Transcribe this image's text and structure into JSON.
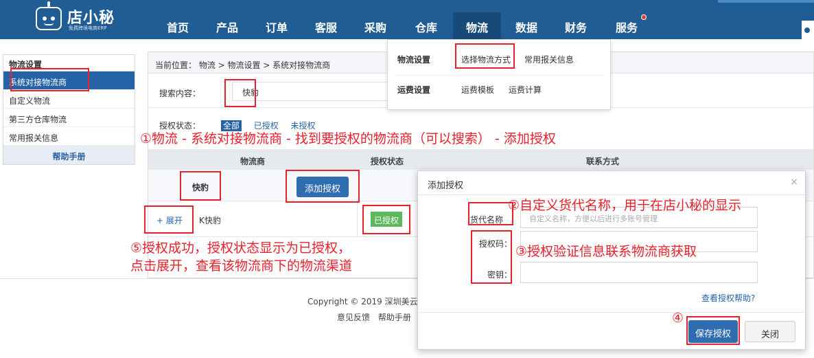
{
  "header": {
    "logo_name": "店小秘",
    "logo_sub": "免费跨境电商ERP",
    "nav": [
      "首页",
      "产品",
      "订单",
      "客服",
      "采购",
      "仓库",
      "物流",
      "数据",
      "财务",
      "服务"
    ]
  },
  "sidebar": {
    "title": "物流设置",
    "items": [
      "系统对接物流商",
      "自定义物流",
      "第三方仓库物流",
      "常用报关信息"
    ],
    "help": "帮助手册"
  },
  "breadcrumb": "当前位置： 物流 > 物流设置 > 系统对接物流商",
  "search": {
    "label": "搜索内容：",
    "value": "快豹"
  },
  "auth_filter": {
    "label": "授权状态：",
    "options": [
      "全部",
      "已授权",
      "未授权"
    ]
  },
  "table": {
    "columns": [
      "物流商",
      "授权状态",
      "联系方式"
    ],
    "group_name": "快豹",
    "add_auth_button": "添加授权",
    "row": {
      "expand": "+ 展开",
      "name": "K快豹",
      "status": "已授权"
    }
  },
  "footer": {
    "copyright": "Copyright © 2019 深圳美云",
    "links": [
      "意见反馈",
      "帮助手册"
    ]
  },
  "dropdown": {
    "groups": [
      {
        "title": "物流设置",
        "items": [
          "选择物流方式",
          "常用报关信息"
        ]
      },
      {
        "title": "运费设置",
        "items": [
          "运费模板",
          "运费计算"
        ]
      }
    ]
  },
  "modal": {
    "title": "添加授权",
    "close_icon": "×",
    "fields": [
      {
        "label": "货代名称",
        "placeholder": "自定义名称，方便以后进行多账号管理"
      },
      {
        "label": "授权码：",
        "placeholder": ""
      },
      {
        "label": "密钥：",
        "placeholder": ""
      }
    ],
    "help_link": "查看授权帮助?",
    "save_button": "保存授权",
    "close_button": "关闭"
  },
  "annotations": {
    "step1": "①物流 - 系统对接物流商 - 找到要授权的物流商（可以搜索） - 添加授权",
    "step2": "②自定义货代名称，用于在店小秘的显示",
    "step3": "③授权验证信息联系物流商获取",
    "step4": "④",
    "step5_line1": "⑤授权成功，授权状态显示为已授权，",
    "step5_line2": "点击展开，查看该物流商下的物流渠道"
  },
  "colors": {
    "nav_bg": "#1f5d94",
    "primary": "#2563a6",
    "success": "#5cb85c",
    "annotation": "#e8212b"
  }
}
